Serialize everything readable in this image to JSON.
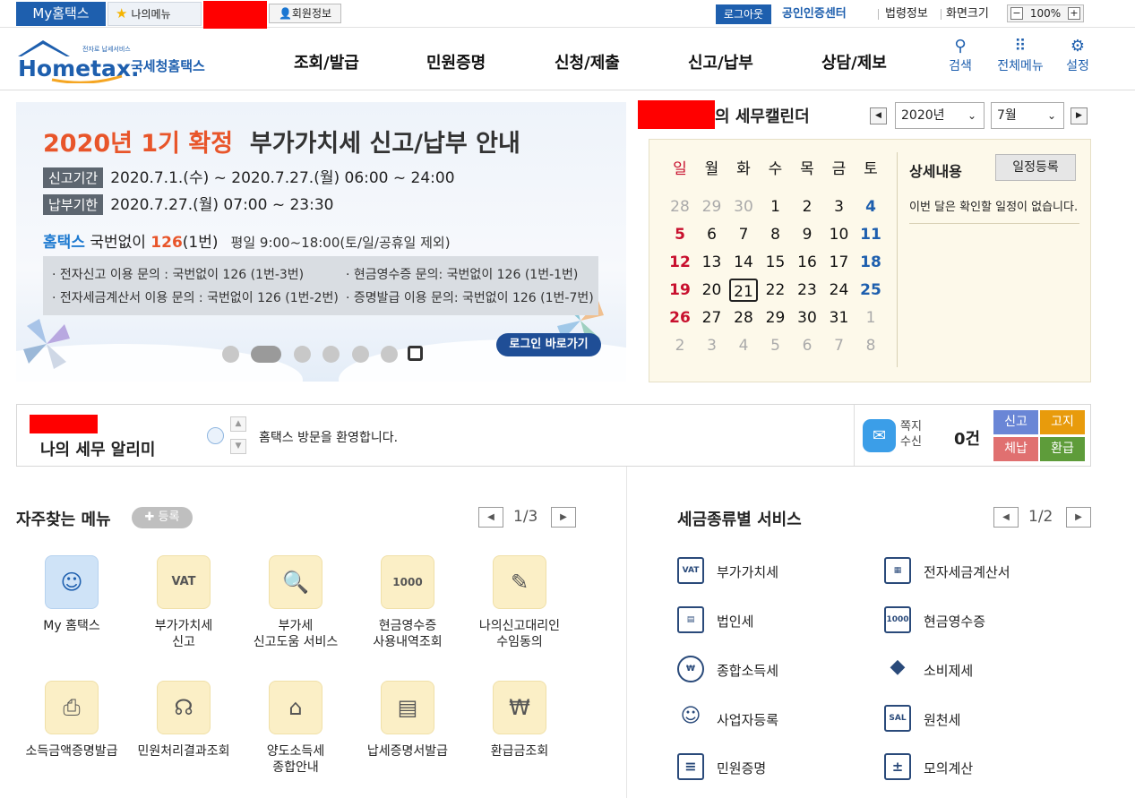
{
  "topbar": {
    "my_hometax": "My홈택스",
    "my_menu": "나의메뉴",
    "member_info": "회원정보",
    "logout": "로그아웃",
    "cert_center": "공인인증센터",
    "law_info": "법령정보",
    "screen_size": "화면크기",
    "zoom": "100%",
    "zoom_minus": "−",
    "zoom_plus": "+"
  },
  "header": {
    "logo_tagline": "전자로 납세서비스",
    "logo_word": "Hometax.",
    "logo_name": "국세청홈택스",
    "nav": [
      "조회/발급",
      "민원증명",
      "신청/제출",
      "신고/납부",
      "상담/제보"
    ],
    "tools": [
      {
        "label": "검색",
        "icon": "search-icon"
      },
      {
        "label": "전체메뉴",
        "icon": "grid-icon"
      },
      {
        "label": "설정",
        "icon": "gear-icon"
      }
    ]
  },
  "banner": {
    "title_highlight": "2020년 1기 확정",
    "title_rest": "부가가치세 신고/납부 안내",
    "period_tag": "신고기간",
    "period_text": "2020.7.1.(수) ~ 2020.7.27.(월) 06:00 ~ 24:00",
    "pay_tag": "납부기한",
    "pay_text": "2020.7.27.(월) 07:00 ~ 23:30",
    "call_hometax": "홈택스",
    "call_prefix": "국번없이",
    "call_number": "126",
    "call_ext": "(1번)",
    "call_hours": "평일 9:00~18:00(토/일/공휴일 제외)",
    "info": [
      "· 전자신고 이용 문의 : 국번없이 126 (1번-3번)",
      "· 현금영수증 문의: 국번없이 126 (1번-1번)",
      "· 전자세금계산서 이용 문의 : 국번없이 126 (1번-2번)",
      "· 증명발급 이용 문의: 국번없이 126 (1번-7번)"
    ],
    "login_button": "로그인 바로가기",
    "slide_count": 7,
    "active_slide": 2
  },
  "calendar": {
    "title": "의 세무캘린더",
    "year": "2020년",
    "month": "7월",
    "weekdays": [
      "일",
      "월",
      "화",
      "수",
      "목",
      "금",
      "토"
    ],
    "weeks": [
      [
        "28",
        "29",
        "30",
        "1",
        "2",
        "3",
        "4"
      ],
      [
        "5",
        "6",
        "7",
        "8",
        "9",
        "10",
        "11"
      ],
      [
        "12",
        "13",
        "14",
        "15",
        "16",
        "17",
        "18"
      ],
      [
        "19",
        "20",
        "21",
        "22",
        "23",
        "24",
        "25"
      ],
      [
        "26",
        "27",
        "28",
        "29",
        "30",
        "31",
        "1"
      ],
      [
        "2",
        "3",
        "4",
        "5",
        "6",
        "7",
        "8"
      ]
    ],
    "today": "21",
    "detail_title": "상세내용",
    "register_button": "일정등록",
    "detail_text": "이번 달은 확인할 일정이 없습니다."
  },
  "alarm": {
    "title": "나의 세무 알리미",
    "message": "홈택스 방문을 환영합니다.",
    "note_label_1": "쪽지",
    "note_label_2": "수신",
    "note_count": "0건",
    "badges": [
      {
        "label": "신고",
        "color": "#6a86d6"
      },
      {
        "label": "고지",
        "color": "#e89b0c"
      },
      {
        "label": "체납",
        "color": "#e07070"
      },
      {
        "label": "환급",
        "color": "#5e9c3a"
      }
    ]
  },
  "quick_menu": {
    "title": "자주찾는 메뉴",
    "register": "등록",
    "page": "1/3",
    "items": [
      {
        "line1": "My 홈택스",
        "line2": "",
        "icon": "user-icon"
      },
      {
        "line1": "부가가치세",
        "line2": "신고",
        "icon": "vat-icon"
      },
      {
        "line1": "부가세",
        "line2": "신고도움 서비스",
        "icon": "search-doc-icon"
      },
      {
        "line1": "현금영수증",
        "line2": "사용내역조회",
        "icon": "receipt-icon"
      },
      {
        "line1": "나의신고대리인",
        "line2": "수임동의",
        "icon": "edit-icon"
      },
      {
        "line1": "소득금액증명발급",
        "line2": "",
        "icon": "printer-icon"
      },
      {
        "line1": "민원처리결과조회",
        "line2": "",
        "icon": "headset-icon"
      },
      {
        "line1": "양도소득세",
        "line2": "종합안내",
        "icon": "house-icon"
      },
      {
        "line1": "납세증명서발급",
        "line2": "",
        "icon": "certificate-icon"
      },
      {
        "line1": "환급금조회",
        "line2": "",
        "icon": "refund-icon"
      }
    ]
  },
  "tax_services": {
    "title": "세금종류별 서비스",
    "page": "1/2",
    "items": [
      {
        "label": "부가가치세",
        "icon": "vat-icon",
        "glyph": "VAT"
      },
      {
        "label": "전자세금계산서",
        "icon": "calculator-doc-icon",
        "glyph": "▦"
      },
      {
        "label": "법인세",
        "icon": "building-icon",
        "glyph": "▤"
      },
      {
        "label": "현금영수증",
        "icon": "receipt-icon",
        "glyph": "1000"
      },
      {
        "label": "종합소득세",
        "icon": "money-bag-icon",
        "glyph": "₩"
      },
      {
        "label": "소비제세",
        "icon": "diamond-icon",
        "glyph": "◆"
      },
      {
        "label": "사업자등록",
        "icon": "user-icon",
        "glyph": "☺"
      },
      {
        "label": "원천세",
        "icon": "salary-doc-icon",
        "glyph": "SAL"
      },
      {
        "label": "민원증명",
        "icon": "document-icon",
        "glyph": "≡"
      },
      {
        "label": "모의계산",
        "icon": "calculator-icon",
        "glyph": "±"
      }
    ]
  }
}
